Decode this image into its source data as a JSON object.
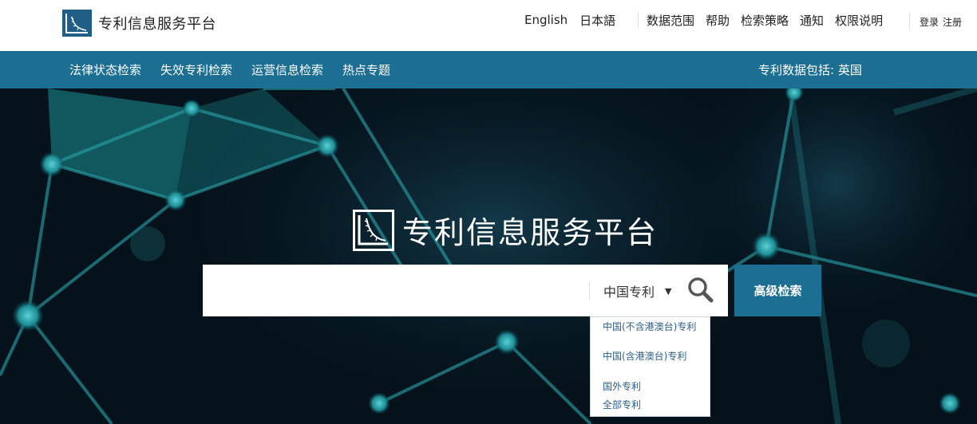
{
  "header": {
    "brand_name": "专利信息服务平台",
    "languages": [
      "English",
      "日本語"
    ],
    "links": [
      "数据范围",
      "帮助",
      "检索策略",
      "通知",
      "权限说明"
    ],
    "auth": [
      "登录",
      "注册"
    ]
  },
  "nav": {
    "items": [
      "法律状态检索",
      "失效专利检索",
      "运营信息检索",
      "热点专题"
    ],
    "scope_text": "专利数据包括: 英国"
  },
  "hero": {
    "title": "专利信息服务平台"
  },
  "search": {
    "placeholder": "",
    "value": "",
    "database_selected": "中国专利",
    "advanced_label": "高级检索",
    "options": [
      "中国(不含港澳台)专利",
      "中国(含港澳台)专利",
      "国外专利",
      "全部专利"
    ]
  },
  "colors": {
    "primary": "#1c6e93",
    "brand_logo": "#1f5f85",
    "hero_bg": "#05121b",
    "link": "#2d5f86"
  }
}
